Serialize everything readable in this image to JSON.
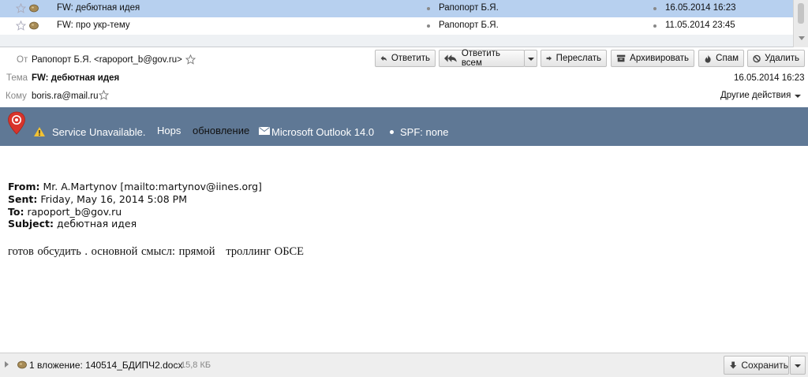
{
  "message_list": {
    "rows": [
      {
        "subject": "FW: дебютная идея",
        "from": "Рапопорт Б.Я.",
        "date": "16.05.2014 16:23"
      },
      {
        "subject": "FW: про укр-тему",
        "from": "Рапопорт Б.Я.",
        "date": "11.05.2014 23:45"
      }
    ]
  },
  "header": {
    "from_label": "От",
    "from_value": "Рапопорт Б.Я. <rapoport_b@gov.ru>",
    "subject_label": "Тема",
    "subject_value": "FW: дебютная идея",
    "to_label": "Кому",
    "to_value": "boris.ra@mail.ru",
    "date": "16.05.2014 16:23",
    "more_actions": "Другие действия"
  },
  "toolbar": {
    "reply": "Ответить",
    "reply_all": "Ответить всем",
    "forward": "Переслать",
    "archive": "Архивировать",
    "spam": "Спам",
    "delete": "Удалить"
  },
  "banner": {
    "service": "Service Unavailable.",
    "hops": "Hops",
    "update": "обновление",
    "client": "Microsoft Outlook 14.0",
    "spf": "SPF: none"
  },
  "body": {
    "from_label": "From:",
    "from_value": "Mr. A.Martynov [mailto:martynov@iines.org]",
    "sent_label": "Sent:",
    "sent_value": "Friday, May 16, 2014 5:08 PM",
    "to_label": "To:",
    "to_value": "rapoport_b@gov.ru",
    "subject_label": "Subject:",
    "subject_value": "дебютная идея",
    "text": "готов обсудить . основной смысл: прямой   троллинг ОБСЕ"
  },
  "attachment": {
    "label": "1 вложение: 140514_БДИПЧ2.docx",
    "size": "15,8 КБ",
    "save": "Сохранить"
  },
  "colors": {
    "selected_row": "#b7d0ef",
    "banner": "#5f7895",
    "warning": "#f2c233",
    "pin": "#d9342b"
  }
}
